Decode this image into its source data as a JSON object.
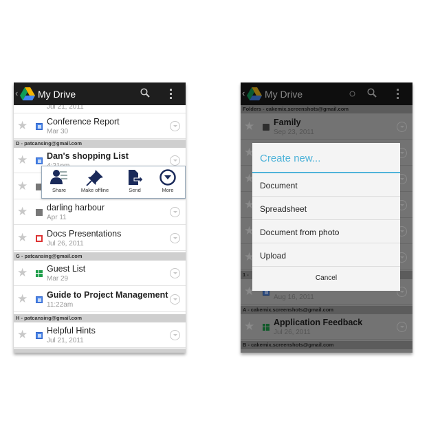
{
  "left": {
    "app_title": "My Drive",
    "partial_top_date": "Jul 21, 2011",
    "rows": [
      {
        "name": "Conference Report",
        "date": "Mar 30",
        "type": "doc",
        "bold": false
      },
      {
        "name": "Dan's shopping List",
        "date": "4:21pm",
        "type": "doc",
        "bold": true
      },
      {
        "name": "",
        "date": "",
        "type": "image",
        "bold": false
      },
      {
        "name": "darling harbour",
        "date": "Apr 11",
        "type": "image",
        "bold": false
      },
      {
        "name": "Docs Presentations",
        "date": "Jul 26, 2011",
        "type": "presentation",
        "bold": false
      },
      {
        "name": "Guest List",
        "date": "Mar 29",
        "type": "spreadsheet",
        "bold": false
      },
      {
        "name": "Guide to Project Management",
        "date": "11:22am",
        "type": "doc",
        "bold": true
      },
      {
        "name": "Helpful Hints",
        "date": "Jul 21, 2011",
        "type": "doc",
        "bold": false
      }
    ],
    "headers": [
      "D - patcansing@gmail.com",
      "G - patcansing@gmail.com",
      "H - patcansing@gmail.com"
    ],
    "quick_actions": {
      "share": "Share",
      "offline": "Make offline",
      "send": "Send",
      "more": "More"
    }
  },
  "right": {
    "app_title": "My Drive",
    "headers": [
      "Folders - cakemix.screenshots@gmail.com",
      "1 -",
      "A - cakemix.screenshots@gmail.com",
      "B - cakemix.screenshots@gmail.com"
    ],
    "rows": [
      {
        "name": "Family",
        "date": "Sep 23, 2011",
        "type": "folder"
      },
      {
        "name": "",
        "date": "Aug 16, 2011",
        "type": "doc"
      },
      {
        "name": "Application Feedback",
        "date": "Jul 26, 2011",
        "type": "spreadsheet"
      }
    ],
    "dialog": {
      "title": "Create new...",
      "items": [
        "Document",
        "Spreadsheet",
        "Document from photo",
        "Upload"
      ],
      "cancel": "Cancel"
    }
  },
  "colors": {
    "accent": "#4fb3d9",
    "action_bar": "#1e1e1e",
    "doc": "#4a86e8",
    "sheet": "#1e9e4a",
    "pres": "#dd3333",
    "action_icons": "#1a2a5a"
  }
}
